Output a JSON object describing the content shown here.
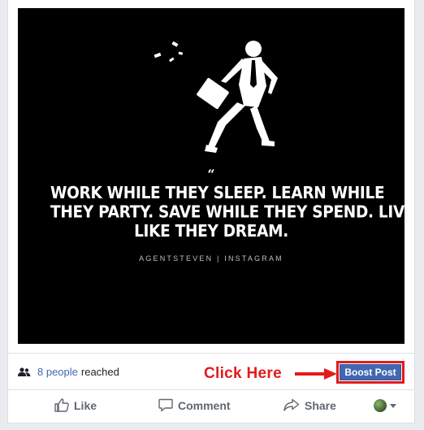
{
  "post": {
    "quote_mark": "“",
    "quote_lines": [
      "WORK WHILE THEY SLEEP. LEARN WHILE",
      "THEY PARTY. SAVE WHILE THEY SPEND. LIVE",
      "LIKE THEY DREAM."
    ],
    "credit": "AGENTSTEVEN | INSTAGRAM"
  },
  "reach": {
    "link_text": "8 people",
    "suffix": "reached",
    "icon": "people-icon"
  },
  "annotation": {
    "text": "Click Here",
    "color": "#e21b1b"
  },
  "boost_button": {
    "label": "Boost Post",
    "color": "#4267b2"
  },
  "actions": {
    "like": "Like",
    "comment": "Comment",
    "share": "Share"
  },
  "icons": {
    "like": "thumbs-up-icon",
    "comment": "comment-icon",
    "share": "share-arrow-icon",
    "audience": "avatar"
  }
}
